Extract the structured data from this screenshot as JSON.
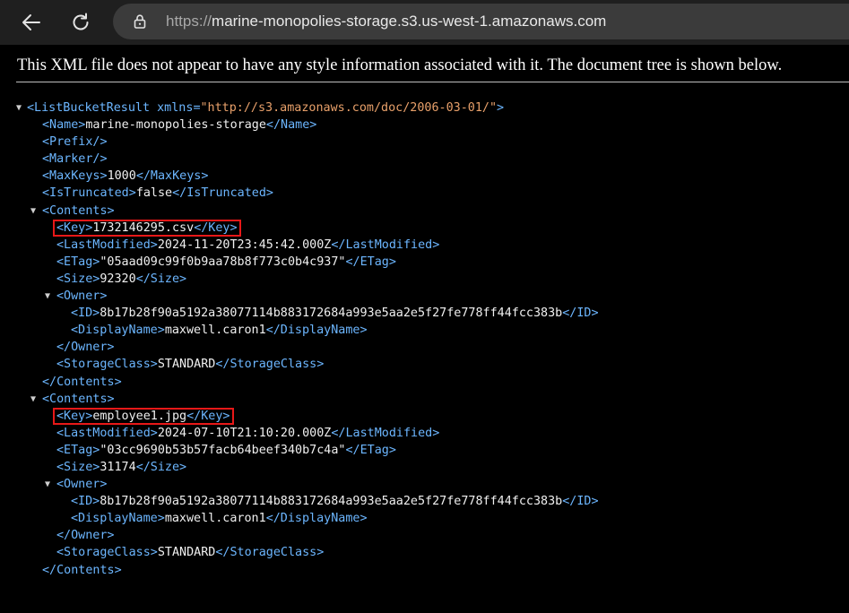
{
  "browser": {
    "url_scheme": "https://",
    "url_host": "marine-monopolies-storage.s3.us-west-1.amazonaws.com",
    "icons": {
      "back": "arrow-left-icon",
      "reload": "reload-icon",
      "site_info": "lock-icon"
    }
  },
  "notice": "This XML file does not appear to have any style information associated with it. The document tree is shown below.",
  "xml": {
    "root_open": "<ListBucketResult",
    "root_attr_name": "xmlns",
    "root_attr_value": "\"http://s3.amazonaws.com/doc/2006-03-01/\"",
    "root_close_bracket": ">",
    "name_open": "<Name>",
    "name_value": "marine-monopolies-storage",
    "name_close": "</Name>",
    "prefix": "<Prefix/>",
    "marker": "<Marker/>",
    "maxkeys_open": "<MaxKeys>",
    "maxkeys_value": "1000",
    "maxkeys_close": "</MaxKeys>",
    "truncated_open": "<IsTruncated>",
    "truncated_value": "false",
    "truncated_close": "</IsTruncated>",
    "contents": [
      {
        "open": "<Contents>",
        "key_open": "<Key>",
        "key": "1732146295.csv",
        "key_close": "</Key>",
        "lm_open": "<LastModified>",
        "last_modified": "2024-11-20T23:45:42.000Z",
        "lm_close": "</LastModified>",
        "etag_open": "<ETag>",
        "etag": "\"05aad09c99f0b9aa78b8f773c0b4c937\"",
        "etag_close": "</ETag>",
        "size_open": "<Size>",
        "size": "92320",
        "size_close": "</Size>",
        "owner_open": "<Owner>",
        "id_open": "<ID>",
        "owner_id": "8b17b28f90a5192a38077114b883172684a993e5aa2e5f27fe778ff44fcc383b",
        "id_close": "</ID>",
        "dn_open": "<DisplayName>",
        "display_name": "maxwell.caron1",
        "dn_close": "</DisplayName>",
        "owner_close": "</Owner>",
        "sc_open": "<StorageClass>",
        "storage_class": "STANDARD",
        "sc_close": "</StorageClass>",
        "close": "</Contents>"
      },
      {
        "open": "<Contents>",
        "key_open": "<Key>",
        "key": "employee1.jpg",
        "key_close": "</Key>",
        "lm_open": "<LastModified>",
        "last_modified": "2024-07-10T21:10:20.000Z",
        "lm_close": "</LastModified>",
        "etag_open": "<ETag>",
        "etag": "\"03cc9690b53b57facb64beef340b7c4a\"",
        "etag_close": "</ETag>",
        "size_open": "<Size>",
        "size": "31174",
        "size_close": "</Size>",
        "owner_open": "<Owner>",
        "id_open": "<ID>",
        "owner_id": "8b17b28f90a5192a38077114b883172684a993e5aa2e5f27fe778ff44fcc383b",
        "id_close": "</ID>",
        "dn_open": "<DisplayName>",
        "display_name": "maxwell.caron1",
        "dn_close": "</DisplayName>",
        "owner_close": "</Owner>",
        "sc_open": "<StorageClass>",
        "storage_class": "STANDARD",
        "sc_close": "</StorageClass>",
        "close": "</Contents>"
      }
    ]
  },
  "colors": {
    "tag": "#6cb6ff",
    "attr_value": "#e8a06a",
    "text": "#f0f0f0",
    "highlight_box": "#e81818",
    "page_bg": "#000000",
    "toolbar_bg": "#1f1f1f",
    "omnibox_bg": "#3b3b3b"
  }
}
